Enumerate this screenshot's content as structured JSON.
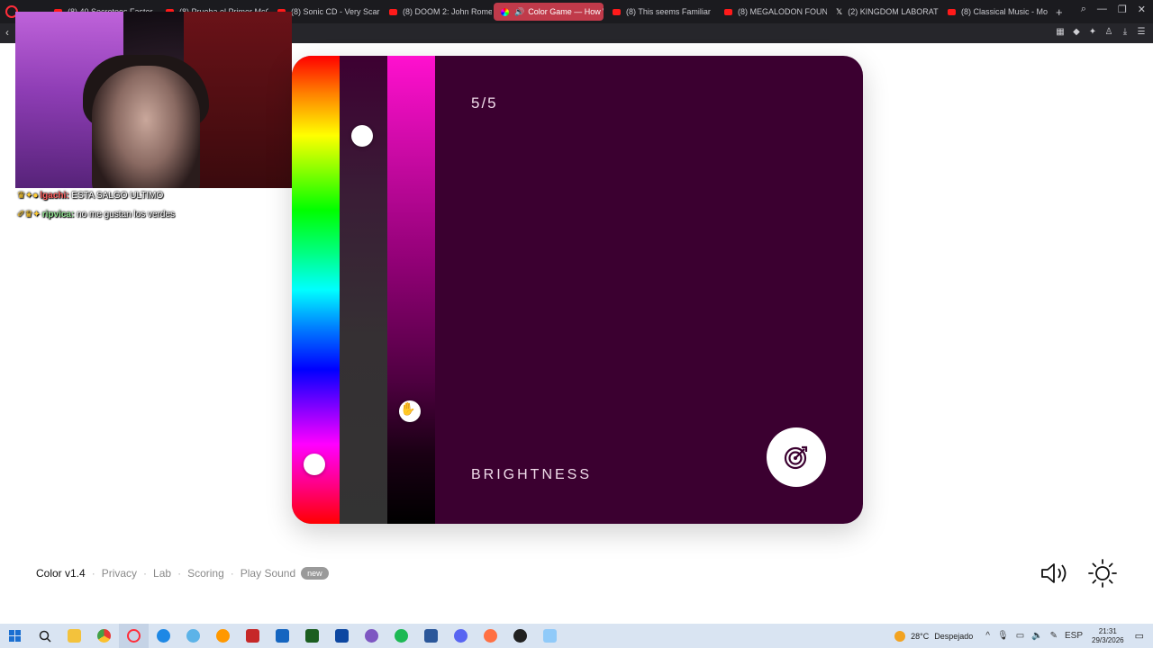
{
  "browser": {
    "tabs": [
      {
        "label": "(8) 40 Secretoos Faster"
      },
      {
        "label": "(8) Prueba el Primer McC"
      },
      {
        "label": "(8) Sonic CD - Very Scar"
      },
      {
        "label": "(8) DOOM 2: John Romer"
      },
      {
        "label": "Color Game — How W",
        "active": true
      },
      {
        "label": "(8) This seems Familiar"
      },
      {
        "label": "(8) MEGALODON FOUND"
      },
      {
        "label": "(2) KINGDOM LABORATO"
      },
      {
        "label": "(8) Classical Music - Mo"
      }
    ],
    "new_tab": "+"
  },
  "chat": [
    {
      "user": "lgachi:",
      "message": "ESTA SALGO ULTIMO"
    },
    {
      "user": "ripvica:",
      "message": "no me gustan los verdes"
    }
  ],
  "game": {
    "round": "5/5",
    "stage": "BRIGHTNESS",
    "sliders": {
      "hue": 0.915,
      "saturation": 0.17,
      "brightness": 0.76
    },
    "colors": {
      "background": "#3b0030",
      "accent": "#ff10cf"
    }
  },
  "footer": {
    "brand": "Color v1.4",
    "links": [
      "Privacy",
      "Lab",
      "Scoring",
      "Play Sound"
    ],
    "badge": "new"
  },
  "taskbar": {
    "weather_temp": "28°C",
    "weather_desc": "Despejado",
    "language": "ESP",
    "time": "21:31",
    "date": "29/3/2026"
  }
}
